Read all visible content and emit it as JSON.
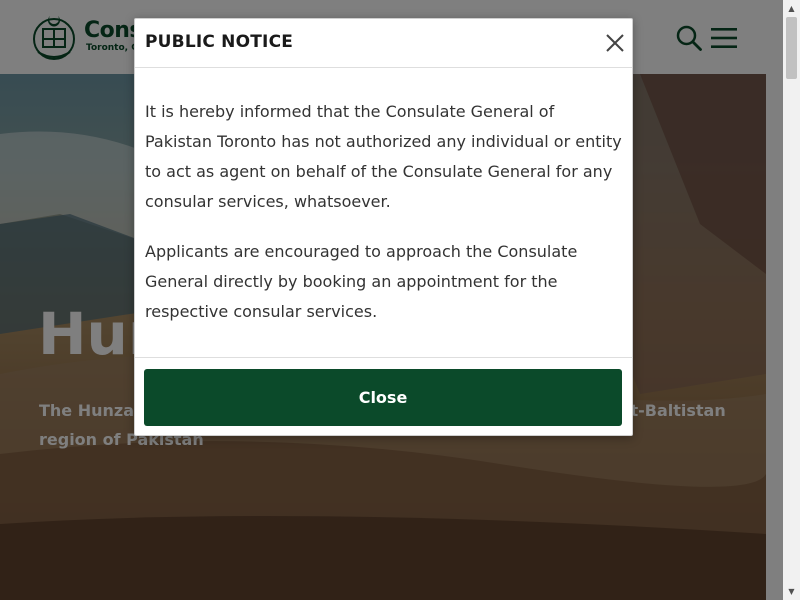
{
  "header": {
    "site_name": "Consu",
    "site_subtitle": "Toronto, Ca",
    "icons": {
      "search": "search-icon",
      "menu": "hamburger-menu-icon",
      "logo": "pakistan-emblem"
    }
  },
  "hero": {
    "title": "Hun",
    "description_start": "The Hunza",
    "description_end": "it-Baltistan",
    "description_line2": "region of Pakistan"
  },
  "modal": {
    "title": "PUBLIC NOTICE",
    "paragraphs": [
      "It is hereby informed that the Consulate General of Pakistan Toronto has not authorized any individual or entity to act as agent on behalf of the Consulate General for any consular services, whatsoever.",
      "Applicants are encouraged to approach the Consulate General directly by booking an appointment for the respective consular services."
    ],
    "close_label": "Close",
    "close_icon": "close-icon"
  },
  "colors": {
    "brand_green": "#0b4a2a",
    "overlay": "rgba(0,0,0,0.5)"
  }
}
